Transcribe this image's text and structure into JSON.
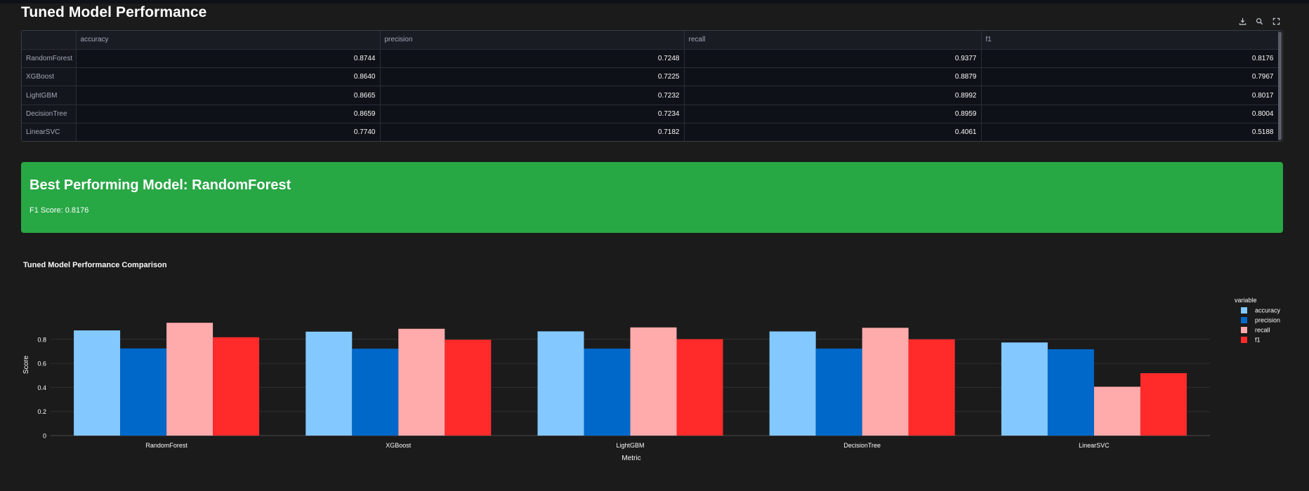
{
  "page": {
    "title": "Tuned Model Performance"
  },
  "toolbar": {
    "icons": [
      "download-icon",
      "search-icon",
      "fullscreen-icon"
    ]
  },
  "table": {
    "columns": [
      "",
      "accuracy",
      "precision",
      "recall",
      "f1"
    ],
    "rows": [
      {
        "model": "RandomForest",
        "accuracy": "0.8744",
        "precision": "0.7248",
        "recall": "0.9377",
        "f1": "0.8176"
      },
      {
        "model": "XGBoost",
        "accuracy": "0.8640",
        "precision": "0.7225",
        "recall": "0.8879",
        "f1": "0.7967"
      },
      {
        "model": "LightGBM",
        "accuracy": "0.8665",
        "precision": "0.7232",
        "recall": "0.8992",
        "f1": "0.8017"
      },
      {
        "model": "DecisionTree",
        "accuracy": "0.8659",
        "precision": "0.7234",
        "recall": "0.8959",
        "f1": "0.8004"
      },
      {
        "model": "LinearSVC",
        "accuracy": "0.7740",
        "precision": "0.7182",
        "recall": "0.4061",
        "f1": "0.5188"
      }
    ]
  },
  "best": {
    "title": "Best Performing Model: RandomForest",
    "score_text": "F1 Score: 0.8176",
    "color": "#28a745"
  },
  "chart_data": {
    "type": "bar",
    "title": "Tuned Model Performance Comparison",
    "xlabel": "Metric",
    "ylabel": "Score",
    "ylim": [
      0,
      0.95
    ],
    "yticks": [
      "0",
      "0.2",
      "0.4",
      "0.6",
      "0.8"
    ],
    "grid": true,
    "legend_title": "variable",
    "legend_placement": "top-right",
    "categories": [
      "RandomForest",
      "XGBoost",
      "LightGBM",
      "DecisionTree",
      "LinearSVC"
    ],
    "series": [
      {
        "name": "accuracy",
        "color": "#83c9ff",
        "values": [
          0.8744,
          0.864,
          0.8665,
          0.8659,
          0.774
        ]
      },
      {
        "name": "precision",
        "color": "#0068c9",
        "values": [
          0.7248,
          0.7225,
          0.7232,
          0.7234,
          0.7182
        ]
      },
      {
        "name": "recall",
        "color": "#ffabab",
        "values": [
          0.9377,
          0.8879,
          0.8992,
          0.8959,
          0.4061
        ]
      },
      {
        "name": "f1",
        "color": "#ff2b2b",
        "values": [
          0.8176,
          0.7967,
          0.8017,
          0.8004,
          0.5188
        ]
      }
    ]
  }
}
